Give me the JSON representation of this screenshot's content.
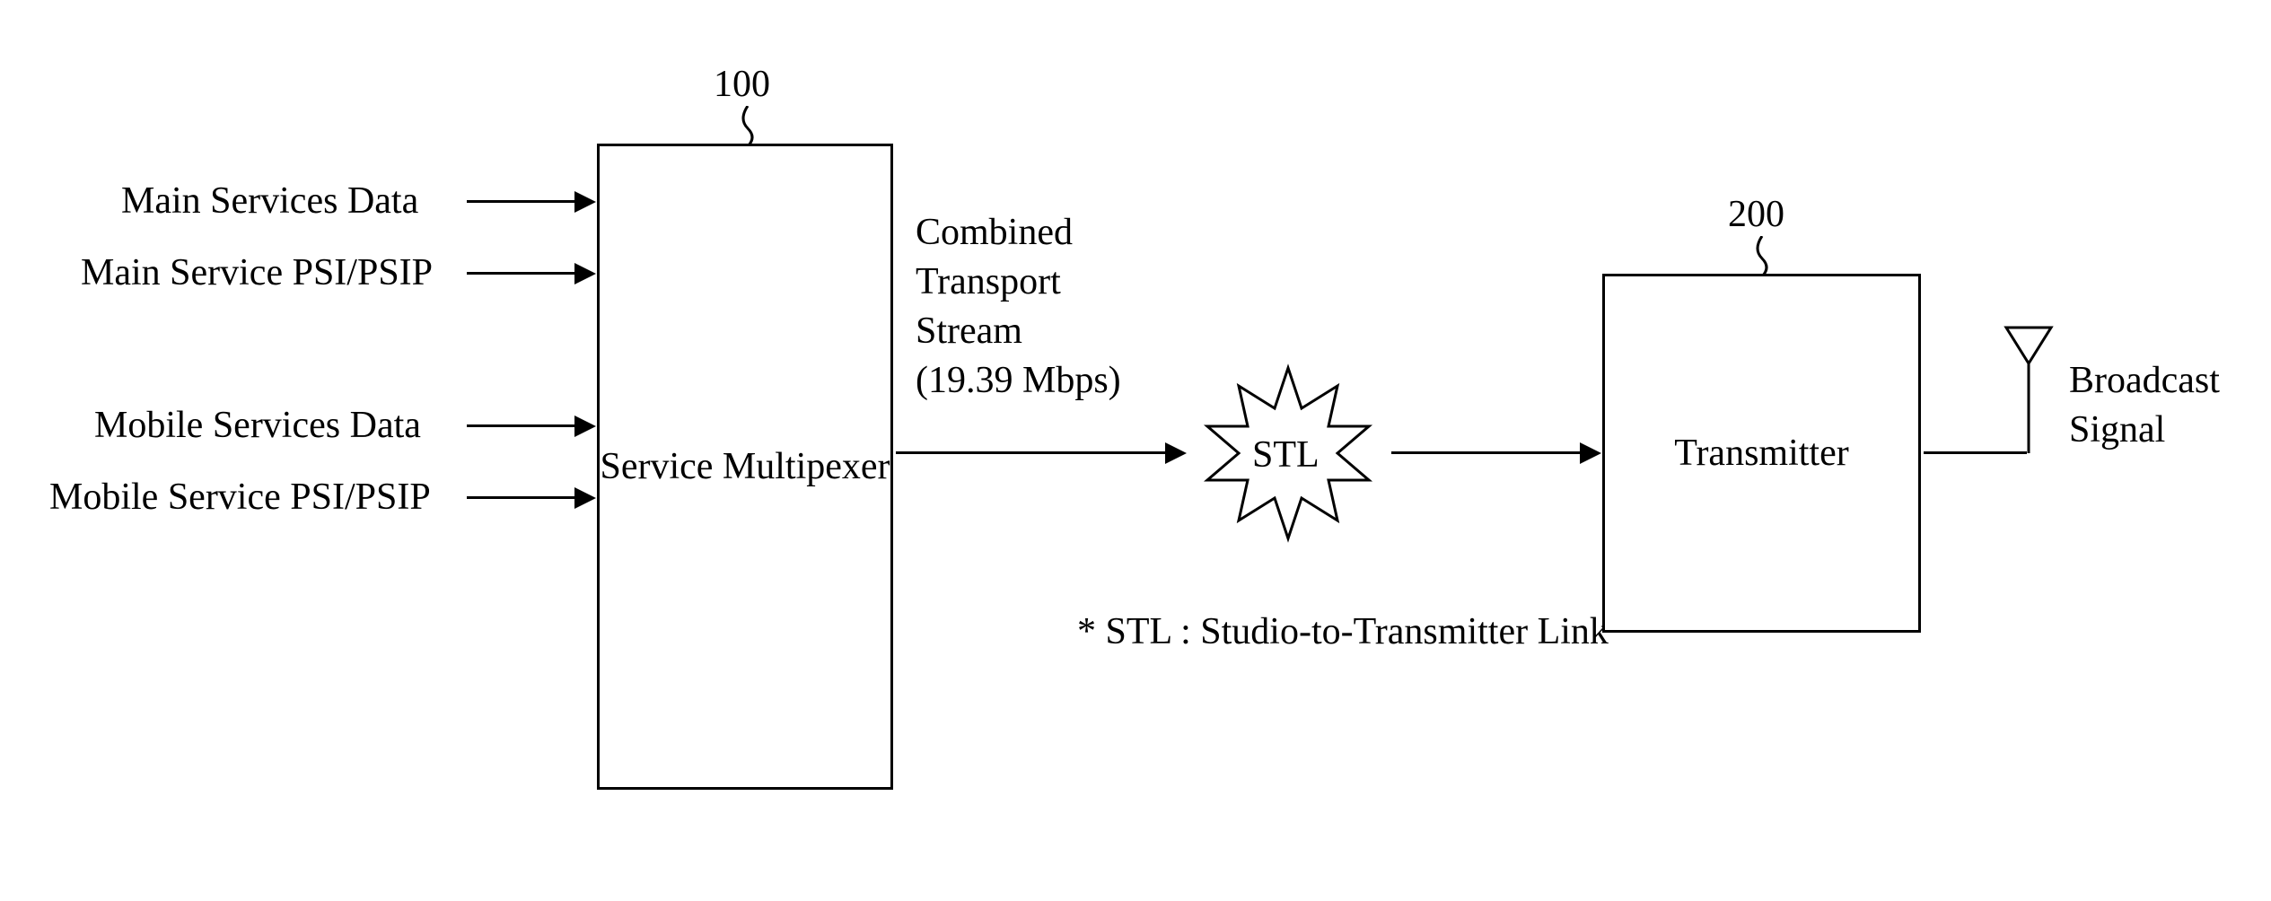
{
  "inputs": {
    "main_data": "Main Services Data",
    "main_psi": "Main Service PSI/PSIP",
    "mobile_data": "Mobile Services Data",
    "mobile_psi": "Mobile Service PSI/PSIP"
  },
  "multiplexer": {
    "ref": "100",
    "label": "Service\nMultipexer"
  },
  "mux_output": {
    "line1": "Combined",
    "line2": "Transport",
    "line3": "Stream",
    "line4": "(19.39 Mbps)"
  },
  "stl": {
    "label": "STL",
    "footnote": "* STL : Studio-to-Transmitter Link"
  },
  "transmitter": {
    "ref": "200",
    "label": "Transmitter"
  },
  "output": {
    "line1": "Broadcast",
    "line2": "Signal"
  }
}
